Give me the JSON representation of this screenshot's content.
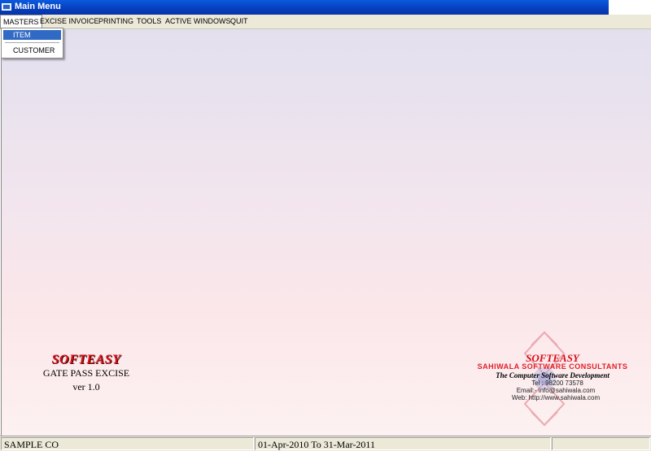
{
  "window": {
    "title": "Main Menu",
    "icon": "app-icon"
  },
  "menubar": {
    "items": [
      {
        "label": "MASTERS"
      },
      {
        "label": "EXCISE INVOICE"
      },
      {
        "label": "PRINTING"
      },
      {
        "label": "TOOLS"
      },
      {
        "label": "ACTIVE WINDOWS"
      },
      {
        "label": "QUIT"
      }
    ]
  },
  "dropdown": {
    "items": [
      {
        "label": "ITEM",
        "highlighted": true
      },
      {
        "label": "CUSTOMER",
        "highlighted": false
      }
    ]
  },
  "logo_left": {
    "brand": "SOFTEASY",
    "product": "GATE PASS EXCISE",
    "version": "ver 1.0"
  },
  "logo_right": {
    "brand": "SOFTEASY",
    "company": "SAHIWALA SOFTWARE CONSULTANTS",
    "tagline": "The Computer Software Development",
    "tel": "Tel : 98200 73578",
    "email": "Email:- info@sahiwala.com",
    "web": "Web: http://www.sahiwala.com"
  },
  "statusbar": {
    "company": "SAMPLE CO",
    "period": "01-Apr-2010 To 31-Mar-2011",
    "extra": ""
  },
  "colors": {
    "titlebar": "#0744c4",
    "menu_highlight": "#316ac5",
    "brand_red": "#d9101a"
  }
}
